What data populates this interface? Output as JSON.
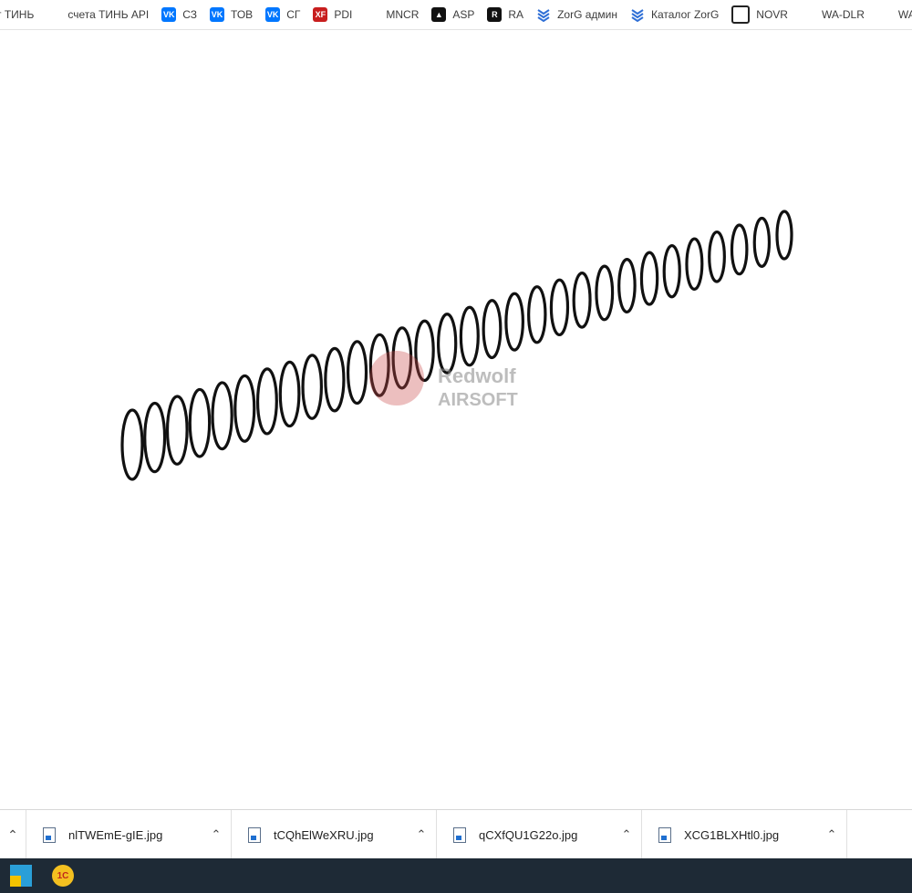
{
  "bookmarks": [
    {
      "label": "т ТИНЬ",
      "icon": "none"
    },
    {
      "label": "счета ТИНЬ API",
      "icon": "gear-badge-icon"
    },
    {
      "label": "СЗ",
      "icon": "vk-icon"
    },
    {
      "label": "ТОВ",
      "icon": "vk-icon"
    },
    {
      "label": "СГ",
      "icon": "vk-icon"
    },
    {
      "label": "PDI",
      "icon": "pdi-icon"
    },
    {
      "label": "MNCR",
      "icon": "mncr-icon"
    },
    {
      "label": "ASP",
      "icon": "asp-icon"
    },
    {
      "label": "RA",
      "icon": "ra-icon"
    },
    {
      "label": "ZorG админ",
      "icon": "zorg-icon"
    },
    {
      "label": "Каталог ZorG",
      "icon": "zorg-icon"
    },
    {
      "label": "NOVR",
      "icon": "novr-icon"
    },
    {
      "label": "WA-DLR",
      "icon": "wa-icon"
    },
    {
      "label": "WA DI",
      "icon": "wa-icon"
    }
  ],
  "downloads": [
    {
      "filename": "nlTWEmE-gIE.jpg"
    },
    {
      "filename": "tCQhElWeXRU.jpg"
    },
    {
      "filename": "qCXfQU1G22o.jpg"
    },
    {
      "filename": "XCG1BLXHtl0.jpg"
    }
  ],
  "watermark": {
    "line1": "Redwolf",
    "line2": "AIRSOFT"
  },
  "taskbar": {
    "app2_label": "1С"
  },
  "glyphs": {
    "chevron_up": "⌃",
    "vk": "VK",
    "pdi": "XF",
    "asp": "▲",
    "ra": "R",
    "zorg": "ᗯ",
    "novr": "+",
    "wa": "✦",
    "gear": "⚙",
    "mncr": "◢"
  }
}
